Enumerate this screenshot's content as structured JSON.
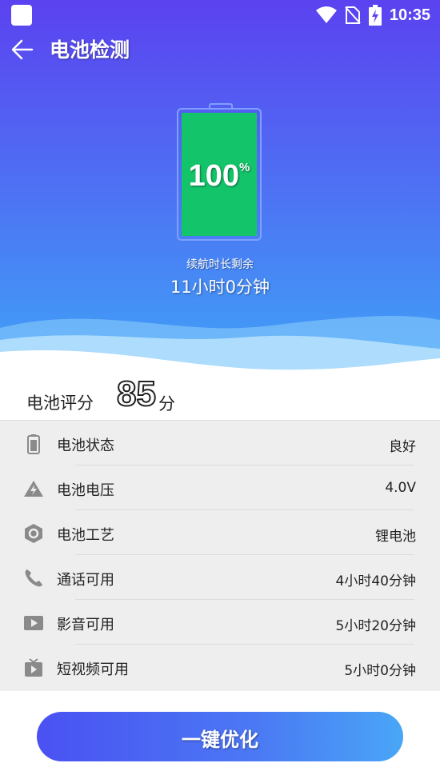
{
  "status_bar": {
    "time": "10:35",
    "icons": [
      "app-icon",
      "wifi-icon",
      "no-sim-icon",
      "battery-charging-icon"
    ]
  },
  "header": {
    "title": "电池检测",
    "back_icon": "arrow-left-icon"
  },
  "battery": {
    "percent": "100",
    "percent_unit": "%",
    "remaining_label": "续航时长剩余",
    "remaining_value": "11小时0分钟",
    "fill_fraction": 1.0,
    "fill_color": "#13c46a"
  },
  "score": {
    "label": "电池评分",
    "value": "85",
    "unit": "分"
  },
  "details": [
    {
      "icon": "battery-icon",
      "label": "电池状态",
      "value": "良好"
    },
    {
      "icon": "voltage-icon",
      "label": "电池电压",
      "value": "4.0V"
    },
    {
      "icon": "hexagon-gear-icon",
      "label": "电池工艺",
      "value": "锂电池"
    },
    {
      "icon": "phone-icon",
      "label": "通话可用",
      "value": "4小时40分钟"
    },
    {
      "icon": "video-icon",
      "label": "影音可用",
      "value": "5小时20分钟"
    },
    {
      "icon": "tv-icon",
      "label": "短视频可用",
      "value": "5小时0分钟"
    }
  ],
  "action": {
    "label": "一键优化"
  },
  "colors": {
    "accent": "#4f6cf3",
    "header_top": "#5b42f0",
    "header_bottom": "#3fa3f7",
    "list_bg": "#eeeeee"
  }
}
